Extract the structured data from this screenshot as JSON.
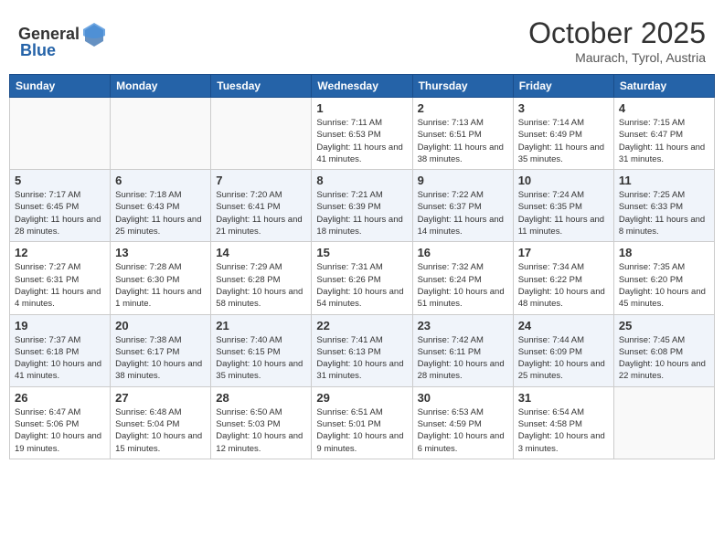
{
  "header": {
    "logo_general": "General",
    "logo_blue": "Blue",
    "title": "October 2025",
    "subtitle": "Maurach, Tyrol, Austria"
  },
  "days_of_week": [
    "Sunday",
    "Monday",
    "Tuesday",
    "Wednesday",
    "Thursday",
    "Friday",
    "Saturday"
  ],
  "weeks": [
    [
      {
        "day": "",
        "info": ""
      },
      {
        "day": "",
        "info": ""
      },
      {
        "day": "",
        "info": ""
      },
      {
        "day": "1",
        "info": "Sunrise: 7:11 AM\nSunset: 6:53 PM\nDaylight: 11 hours and 41 minutes."
      },
      {
        "day": "2",
        "info": "Sunrise: 7:13 AM\nSunset: 6:51 PM\nDaylight: 11 hours and 38 minutes."
      },
      {
        "day": "3",
        "info": "Sunrise: 7:14 AM\nSunset: 6:49 PM\nDaylight: 11 hours and 35 minutes."
      },
      {
        "day": "4",
        "info": "Sunrise: 7:15 AM\nSunset: 6:47 PM\nDaylight: 11 hours and 31 minutes."
      }
    ],
    [
      {
        "day": "5",
        "info": "Sunrise: 7:17 AM\nSunset: 6:45 PM\nDaylight: 11 hours and 28 minutes."
      },
      {
        "day": "6",
        "info": "Sunrise: 7:18 AM\nSunset: 6:43 PM\nDaylight: 11 hours and 25 minutes."
      },
      {
        "day": "7",
        "info": "Sunrise: 7:20 AM\nSunset: 6:41 PM\nDaylight: 11 hours and 21 minutes."
      },
      {
        "day": "8",
        "info": "Sunrise: 7:21 AM\nSunset: 6:39 PM\nDaylight: 11 hours and 18 minutes."
      },
      {
        "day": "9",
        "info": "Sunrise: 7:22 AM\nSunset: 6:37 PM\nDaylight: 11 hours and 14 minutes."
      },
      {
        "day": "10",
        "info": "Sunrise: 7:24 AM\nSunset: 6:35 PM\nDaylight: 11 hours and 11 minutes."
      },
      {
        "day": "11",
        "info": "Sunrise: 7:25 AM\nSunset: 6:33 PM\nDaylight: 11 hours and 8 minutes."
      }
    ],
    [
      {
        "day": "12",
        "info": "Sunrise: 7:27 AM\nSunset: 6:31 PM\nDaylight: 11 hours and 4 minutes."
      },
      {
        "day": "13",
        "info": "Sunrise: 7:28 AM\nSunset: 6:30 PM\nDaylight: 11 hours and 1 minute."
      },
      {
        "day": "14",
        "info": "Sunrise: 7:29 AM\nSunset: 6:28 PM\nDaylight: 10 hours and 58 minutes."
      },
      {
        "day": "15",
        "info": "Sunrise: 7:31 AM\nSunset: 6:26 PM\nDaylight: 10 hours and 54 minutes."
      },
      {
        "day": "16",
        "info": "Sunrise: 7:32 AM\nSunset: 6:24 PM\nDaylight: 10 hours and 51 minutes."
      },
      {
        "day": "17",
        "info": "Sunrise: 7:34 AM\nSunset: 6:22 PM\nDaylight: 10 hours and 48 minutes."
      },
      {
        "day": "18",
        "info": "Sunrise: 7:35 AM\nSunset: 6:20 PM\nDaylight: 10 hours and 45 minutes."
      }
    ],
    [
      {
        "day": "19",
        "info": "Sunrise: 7:37 AM\nSunset: 6:18 PM\nDaylight: 10 hours and 41 minutes."
      },
      {
        "day": "20",
        "info": "Sunrise: 7:38 AM\nSunset: 6:17 PM\nDaylight: 10 hours and 38 minutes."
      },
      {
        "day": "21",
        "info": "Sunrise: 7:40 AM\nSunset: 6:15 PM\nDaylight: 10 hours and 35 minutes."
      },
      {
        "day": "22",
        "info": "Sunrise: 7:41 AM\nSunset: 6:13 PM\nDaylight: 10 hours and 31 minutes."
      },
      {
        "day": "23",
        "info": "Sunrise: 7:42 AM\nSunset: 6:11 PM\nDaylight: 10 hours and 28 minutes."
      },
      {
        "day": "24",
        "info": "Sunrise: 7:44 AM\nSunset: 6:09 PM\nDaylight: 10 hours and 25 minutes."
      },
      {
        "day": "25",
        "info": "Sunrise: 7:45 AM\nSunset: 6:08 PM\nDaylight: 10 hours and 22 minutes."
      }
    ],
    [
      {
        "day": "26",
        "info": "Sunrise: 6:47 AM\nSunset: 5:06 PM\nDaylight: 10 hours and 19 minutes."
      },
      {
        "day": "27",
        "info": "Sunrise: 6:48 AM\nSunset: 5:04 PM\nDaylight: 10 hours and 15 minutes."
      },
      {
        "day": "28",
        "info": "Sunrise: 6:50 AM\nSunset: 5:03 PM\nDaylight: 10 hours and 12 minutes."
      },
      {
        "day": "29",
        "info": "Sunrise: 6:51 AM\nSunset: 5:01 PM\nDaylight: 10 hours and 9 minutes."
      },
      {
        "day": "30",
        "info": "Sunrise: 6:53 AM\nSunset: 4:59 PM\nDaylight: 10 hours and 6 minutes."
      },
      {
        "day": "31",
        "info": "Sunrise: 6:54 AM\nSunset: 4:58 PM\nDaylight: 10 hours and 3 minutes."
      },
      {
        "day": "",
        "info": ""
      }
    ]
  ]
}
